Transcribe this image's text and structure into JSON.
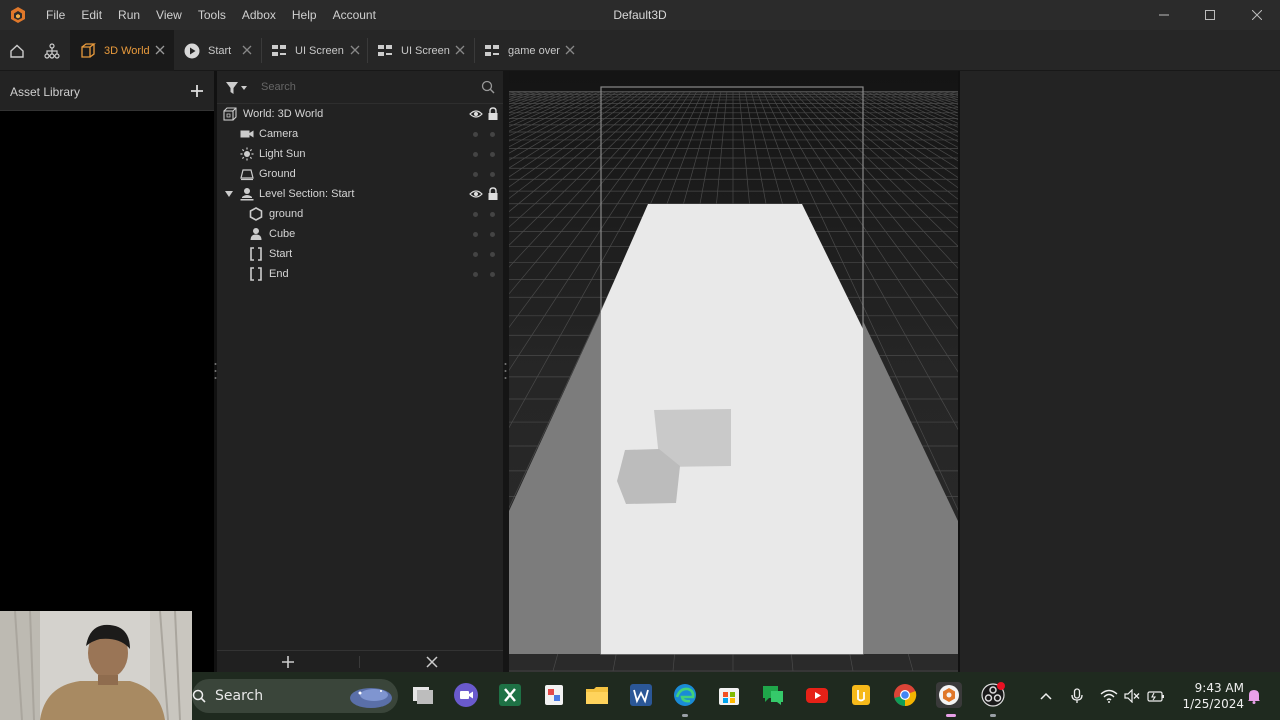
{
  "window": {
    "title": "Default3D",
    "menu": [
      "File",
      "Edit",
      "Run",
      "View",
      "Tools",
      "Adbox",
      "Help",
      "Account"
    ]
  },
  "tabs": [
    {
      "label": "3D World",
      "icon": "cube-icon",
      "active": true
    },
    {
      "label": "Start",
      "icon": "play-icon",
      "active": false
    },
    {
      "label": "UI Screen",
      "icon": "ui-screen-icon",
      "active": false
    },
    {
      "label": "UI Screen",
      "icon": "ui-screen-icon",
      "active": false
    },
    {
      "label": "game over",
      "icon": "ui-screen-icon",
      "active": false
    }
  ],
  "asset_library": {
    "title": "Asset Library"
  },
  "hierarchy": {
    "search_placeholder": "Search",
    "items": [
      {
        "label": "World: 3D World",
        "icon": "world-icon"
      },
      {
        "label": "Camera",
        "icon": "camera-icon"
      },
      {
        "label": "Light Sun",
        "icon": "sun-icon"
      },
      {
        "label": "Ground",
        "icon": "ground-icon"
      },
      {
        "label": "Level Section: Start",
        "icon": "level-section-icon"
      },
      {
        "label": "ground",
        "icon": "hexagon-icon"
      },
      {
        "label": "Cube",
        "icon": "person-icon"
      },
      {
        "label": "Start",
        "icon": "bracket-icon"
      },
      {
        "label": "End",
        "icon": "bracket-icon"
      }
    ]
  },
  "taskbar": {
    "search_label": "Search",
    "time": "9:43 AM",
    "date": "1/25/2024"
  },
  "colors": {
    "accent": "#e89a3c",
    "background": "#1e1e1e",
    "panel": "#222222"
  }
}
